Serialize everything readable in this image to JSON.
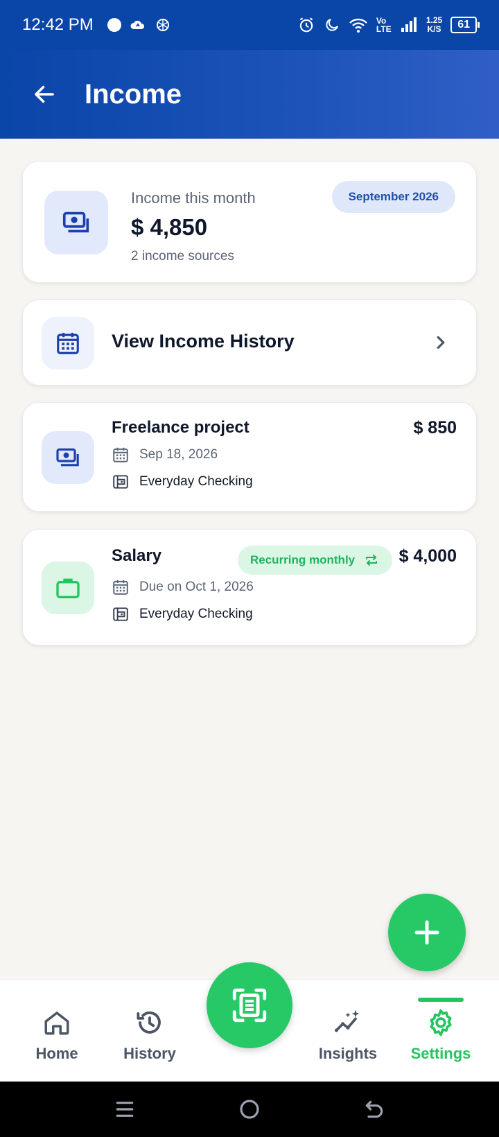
{
  "status_bar": {
    "time": "12:42 PM",
    "network_label": "Vo LTE",
    "speed_value": "1.25",
    "speed_unit": "K/S",
    "battery": "61"
  },
  "header": {
    "title": "Income"
  },
  "summary": {
    "label": "Income this month",
    "amount": "$ 4,850",
    "sources": "2 income sources",
    "month": "September 2026"
  },
  "history_link": {
    "label": "View Income History"
  },
  "transactions": [
    {
      "title": "Freelance project",
      "amount": "$ 850",
      "date": "Sep 18, 2026",
      "account": "Everyday Checking",
      "icon": "money-icon"
    },
    {
      "title": "Salary",
      "amount": "$ 4,000",
      "date": "Due on Oct 1, 2026",
      "account": "Everyday Checking",
      "recurring": "Recurring monthly",
      "icon": "briefcase-icon"
    }
  ],
  "nav": {
    "items": [
      {
        "label": "Home",
        "icon": "home-icon"
      },
      {
        "label": "History",
        "icon": "history-icon"
      },
      {
        "label": "Insights",
        "icon": "insights-icon"
      },
      {
        "label": "Settings",
        "icon": "gear-icon",
        "active": true
      }
    ]
  },
  "colors": {
    "primary": "#0a45a8",
    "accent_green": "#27c967",
    "background": "#f7f5f1"
  }
}
